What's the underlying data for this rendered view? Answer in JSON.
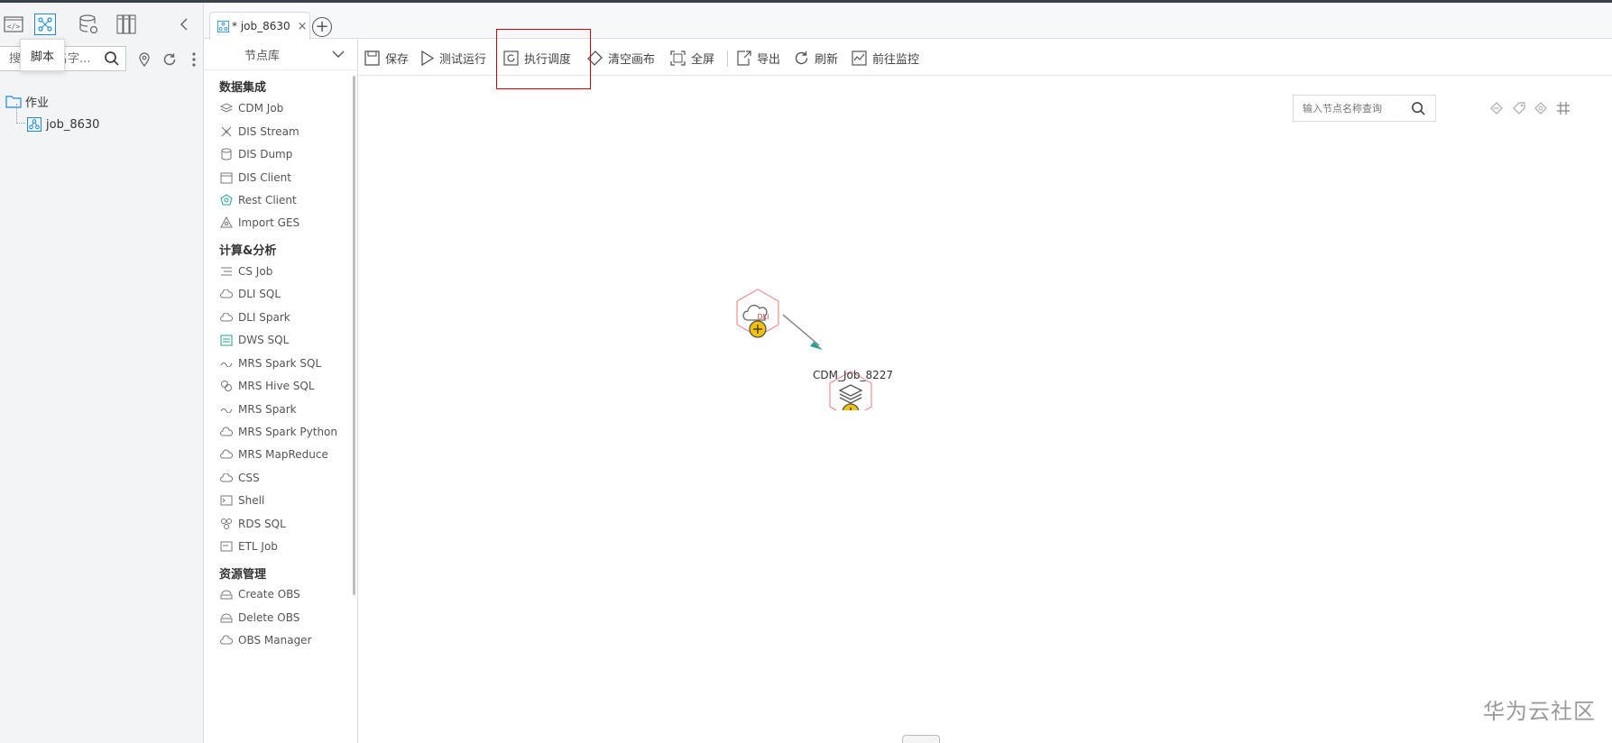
{
  "left_panel": {
    "tooltip": "脚本",
    "search_placeholder": "搜索作业名字...",
    "tree": {
      "root_label": "作业",
      "child_label": "job_8630"
    }
  },
  "tabs": [
    {
      "label": "* job_8630",
      "close": "×"
    }
  ],
  "tab_add": "+",
  "node_library": {
    "title": "节点库",
    "categories": [
      {
        "name": "数据集成",
        "items": [
          "CDM Job",
          "DIS Stream",
          "DIS Dump",
          "DIS Client",
          "Rest Client",
          "Import GES"
        ]
      },
      {
        "name": "计算&分析",
        "items": [
          "CS Job",
          "DLI SQL",
          "DLI Spark",
          "DWS SQL",
          "MRS Spark SQL",
          "MRS Hive SQL",
          "MRS Spark",
          "MRS Spark Python",
          "MRS MapReduce",
          "CSS",
          "Shell",
          "RDS SQL",
          "ETL Job"
        ]
      },
      {
        "name": "资源管理",
        "items": [
          "Create OBS",
          "Delete OBS",
          "OBS Manager"
        ]
      }
    ]
  },
  "toolbar": {
    "save": "保存",
    "test_run": "测试运行",
    "schedule": "执行调度",
    "clear": "清空画布",
    "fullscreen": "全屏",
    "export": "导出",
    "refresh": "刷新",
    "monitor": "前往监控"
  },
  "canvas": {
    "search_placeholder": "输入节点名称查询",
    "node1_badge": "DLI",
    "node2_label": "CDM_Job_8227"
  },
  "watermark": "华为云社区",
  "colors": {
    "node_border": "#f07a7a",
    "node_add": "#f2c200",
    "edge": "#888888",
    "edge_arrow": "#2a9d8f",
    "highlight": "#cc0000",
    "icon_teal": "#2a9d8f",
    "icon_blue": "#1f8ad6"
  }
}
